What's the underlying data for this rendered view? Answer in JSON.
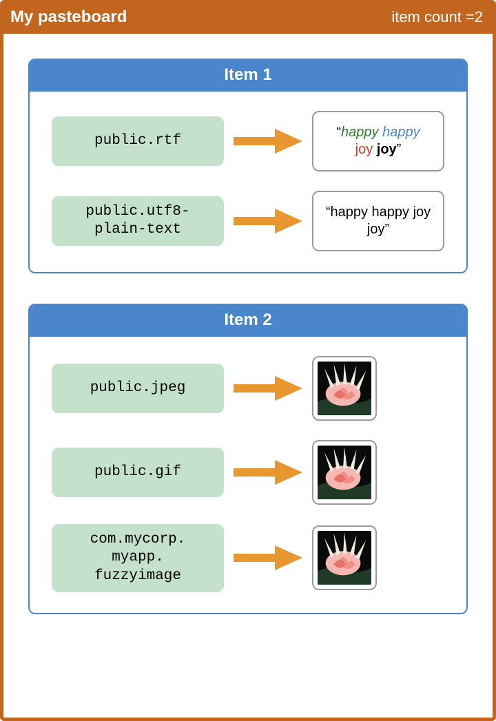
{
  "header": {
    "title": "My pasteboard",
    "count_label": "item count =2"
  },
  "items": [
    {
      "title": "Item 1",
      "reps": [
        {
          "uti": "public.rtf",
          "kind": "rtf",
          "rtf": {
            "quote_open": "“",
            "quote_close": "”",
            "w1": "happy",
            "w2": "happy",
            "w3": "joy",
            "w4": "joy"
          }
        },
        {
          "uti": "public.utf8-\nplain-text",
          "kind": "text",
          "text": "“happy happy joy joy”"
        }
      ]
    },
    {
      "title": "Item 2",
      "reps": [
        {
          "uti": "public.jpeg",
          "kind": "image"
        },
        {
          "uti": "public.gif",
          "kind": "image"
        },
        {
          "uti": "com.mycorp.\nmyapp.\nfuzzyimage",
          "kind": "image"
        }
      ]
    }
  ]
}
